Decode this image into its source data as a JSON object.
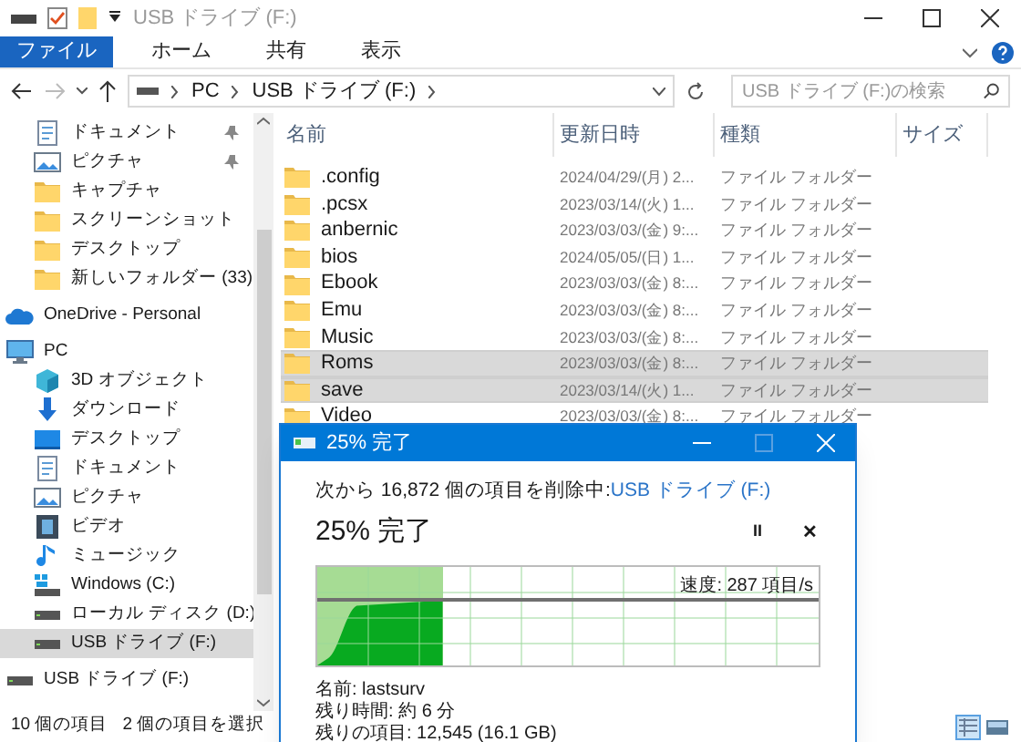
{
  "window": {
    "title": "USB ドライブ (F:)"
  },
  "ribbon": {
    "tabs": [
      {
        "label": "ファイル",
        "selected": true
      },
      {
        "label": "ホーム",
        "selected": false
      },
      {
        "label": "共有",
        "selected": false
      },
      {
        "label": "表示",
        "selected": false
      }
    ]
  },
  "address_bar": {
    "path": [
      "PC",
      "USB ドライブ (F:)"
    ]
  },
  "search": {
    "placeholder": "USB ドライブ (F:)の検索"
  },
  "sidebar": {
    "quick_access": [
      {
        "label": "ドキュメント",
        "kind": "document",
        "pinned": true,
        "selected": false
      },
      {
        "label": "ピクチャ",
        "kind": "picture",
        "pinned": true,
        "selected": false
      },
      {
        "label": "キャプチャ",
        "kind": "folder",
        "pinned": false,
        "selected": false
      },
      {
        "label": "スクリーンショット",
        "kind": "folder",
        "pinned": false,
        "selected": false
      },
      {
        "label": "デスクトップ",
        "kind": "folder",
        "pinned": false,
        "selected": false
      },
      {
        "label": "新しいフォルダー (33)",
        "kind": "folder",
        "pinned": false,
        "selected": false
      }
    ],
    "items": [
      {
        "label": "OneDrive - Personal",
        "kind": "cloud",
        "selected": false
      },
      {
        "label": "PC",
        "kind": "pc",
        "selected": false,
        "children": [
          {
            "label": "3D オブジェクト",
            "kind": "cube",
            "selected": false
          },
          {
            "label": "ダウンロード",
            "kind": "download",
            "selected": false
          },
          {
            "label": "デスクトップ",
            "kind": "desktop",
            "selected": false
          },
          {
            "label": "ドキュメント",
            "kind": "document",
            "selected": false
          },
          {
            "label": "ピクチャ",
            "kind": "picture",
            "selected": false
          },
          {
            "label": "ビデオ",
            "kind": "video",
            "selected": false
          },
          {
            "label": "ミュージック",
            "kind": "music",
            "selected": false
          },
          {
            "label": "Windows (C:)",
            "kind": "windows-drive",
            "selected": false
          },
          {
            "label": "ローカル ディスク (D:)",
            "kind": "drive",
            "selected": false
          },
          {
            "label": "USB ドライブ (F:)",
            "kind": "drive",
            "selected": true
          }
        ]
      },
      {
        "label": "USB ドライブ (F:)",
        "kind": "drive",
        "selected": false
      }
    ]
  },
  "file_list": {
    "columns": [
      "名前",
      "更新日時",
      "種類",
      "サイズ"
    ],
    "rows": [
      {
        "name": ".config",
        "modified": "2024/04/29/(月) 2...",
        "type": "ファイル フォルダー",
        "selected": false
      },
      {
        "name": ".pcsx",
        "modified": "2023/03/14/(火) 1...",
        "type": "ファイル フォルダー",
        "selected": false
      },
      {
        "name": "anbernic",
        "modified": "2023/03/03/(金) 9:...",
        "type": "ファイル フォルダー",
        "selected": false
      },
      {
        "name": "bios",
        "modified": "2024/05/05/(日) 1...",
        "type": "ファイル フォルダー",
        "selected": false
      },
      {
        "name": "Ebook",
        "modified": "2023/03/03/(金) 8:...",
        "type": "ファイル フォルダー",
        "selected": false
      },
      {
        "name": "Emu",
        "modified": "2023/03/03/(金) 8:...",
        "type": "ファイル フォルダー",
        "selected": false
      },
      {
        "name": "Music",
        "modified": "2023/03/03/(金) 8:...",
        "type": "ファイル フォルダー",
        "selected": false
      },
      {
        "name": "Roms",
        "modified": "2023/03/03/(金) 8:...",
        "type": "ファイル フォルダー",
        "selected": true
      },
      {
        "name": "save",
        "modified": "2023/03/14/(火) 1...",
        "type": "ファイル フォルダー",
        "selected": true
      },
      {
        "name": "Video",
        "modified": "2023/03/03/(金) 8:...",
        "type": "ファイル フォルダー",
        "selected": false
      }
    ]
  },
  "status_bar": {
    "item_count": "10 個の項目",
    "selection": "2 個の項目を選択",
    "views": [
      {
        "kind": "details",
        "selected": true
      },
      {
        "kind": "tiles",
        "selected": false
      }
    ]
  },
  "progress_dialog": {
    "title": "25% 完了",
    "description": "次から 16,872 個の項目を削除中: ",
    "target_link": "USB ドライブ (F:)",
    "heading": "25% 完了",
    "pause": "II",
    "cancel": "✕",
    "level": 0.25,
    "speed": "速度: 287 項目/s",
    "details": [
      "名前: lastsurv",
      "残り時間: 約 6 分",
      "残りの項目: 12,545 (16.1 GB)"
    ]
  }
}
